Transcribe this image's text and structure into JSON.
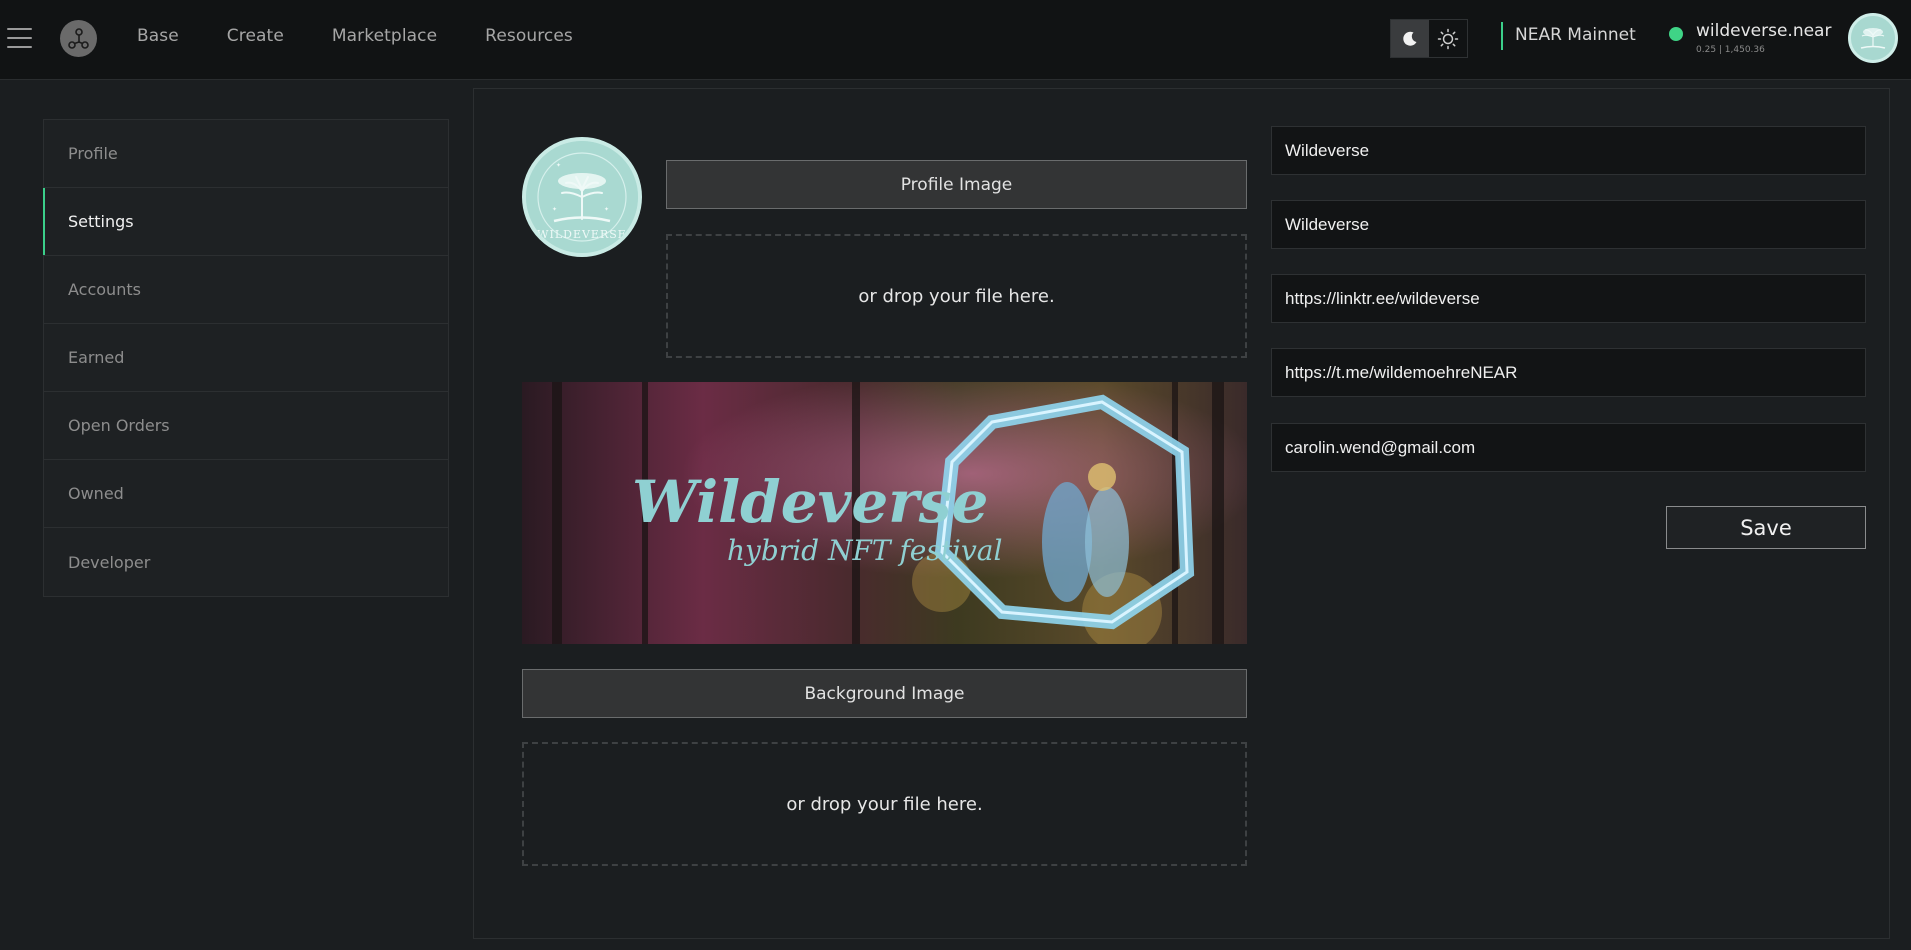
{
  "nav": {
    "items": [
      {
        "label": "Base"
      },
      {
        "label": "Create"
      },
      {
        "label": "Marketplace"
      },
      {
        "label": "Resources"
      }
    ]
  },
  "header": {
    "network": "NEAR Mainnet",
    "account_name": "wildeverse.near",
    "account_balance": "0.25 | 1,450.36",
    "status_color": "#3fd486",
    "accent": "#3bcf8a",
    "theme_active": "dark"
  },
  "sidebar": {
    "items": [
      {
        "label": "Profile"
      },
      {
        "label": "Settings",
        "active": true
      },
      {
        "label": "Accounts"
      },
      {
        "label": "Earned"
      },
      {
        "label": "Open Orders"
      },
      {
        "label": "Owned"
      },
      {
        "label": "Developer"
      }
    ]
  },
  "profile": {
    "image_button": "Profile Image",
    "dropzone_text": "or drop your file here.",
    "avatar_text": "WILDEVERSE"
  },
  "banner": {
    "title": "Wildeverse",
    "subtitle": "hybrid NFT festival"
  },
  "background": {
    "image_button": "Background Image",
    "dropzone_text": "or drop your file here."
  },
  "form": {
    "display_name": "Wildeverse",
    "name": "Wildeverse",
    "website": "https://linktr.ee/wildeverse",
    "telegram": "https://t.me/wildemoehreNEAR",
    "email": "carolin.wend@gmail.com",
    "save_label": "Save"
  }
}
